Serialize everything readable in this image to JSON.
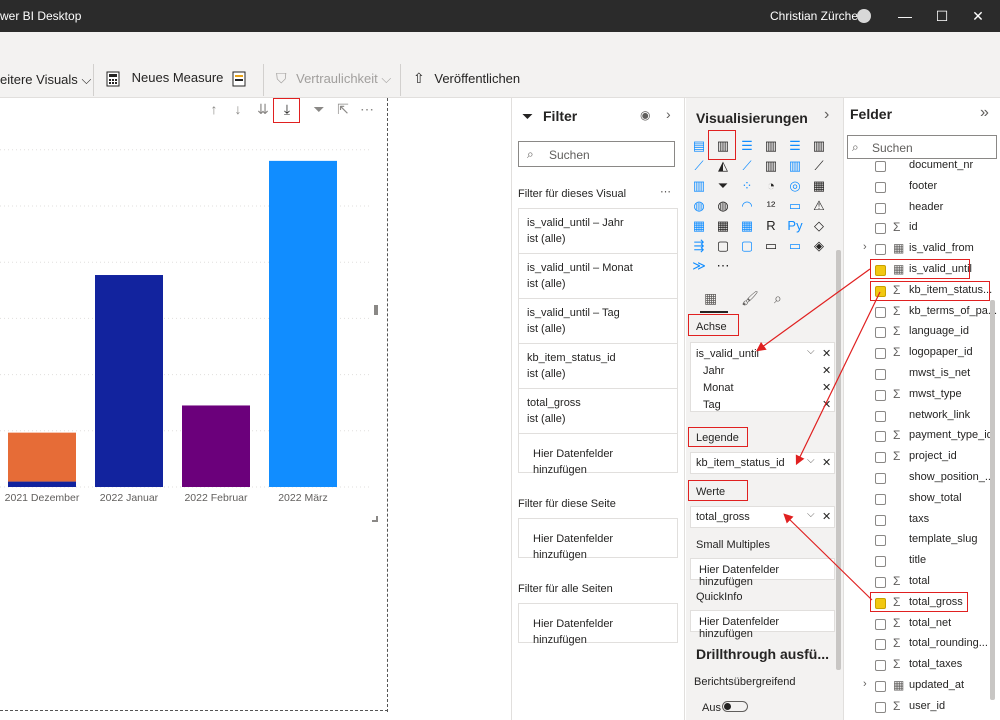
{
  "titlebar": {
    "title": "wer BI Desktop",
    "user": "Christian Zürcher",
    "min": "—",
    "max": "☐",
    "close": "✕"
  },
  "ribbon": {
    "more_visuals": "eitere Visuals",
    "new_measure": "Neues Measure",
    "sensitivity": "Vertraulichkeit",
    "publish": "Veröffentlichen"
  },
  "chart_data": {
    "type": "bar",
    "categories": [
      "2021 Dezember",
      "2022 Januar",
      "2022 Februar",
      "2022 März"
    ],
    "series": [
      {
        "values": [
          0.05,
          0,
          0,
          0
        ],
        "color": "#12239e"
      },
      {
        "values": [
          0.45,
          0,
          0,
          0
        ],
        "color": "#e66c37"
      },
      {
        "values": [
          0,
          1.95,
          0,
          0
        ],
        "color": "#12239e"
      },
      {
        "values": [
          0,
          0,
          0.75,
          0
        ],
        "color": "#6b007b"
      },
      {
        "values": [
          0,
          0,
          0,
          3.0
        ],
        "color": "#118dff"
      }
    ],
    "ylim": [
      0,
      3.1
    ],
    "grid": true
  },
  "filter": {
    "title": "Filter",
    "search_placeholder": "Suchen",
    "visual_section": "Filter für dieses Visual",
    "cards": [
      {
        "name": "is_valid_until – Jahr",
        "value": "ist (alle)"
      },
      {
        "name": "is_valid_until – Monat",
        "value": "ist (alle)"
      },
      {
        "name": "is_valid_until – Tag",
        "value": "ist (alle)"
      },
      {
        "name": "kb_item_status_id",
        "value": "ist (alle)"
      },
      {
        "name": "total_gross",
        "value": "ist (alle)"
      }
    ],
    "add_fields": "Hier Datenfelder hinzufügen",
    "page_section": "Filter für diese Seite",
    "all_section": "Filter für alle Seiten"
  },
  "viz": {
    "title": "Visualisierungen",
    "axis_label": "Achse",
    "axis_field": "is_valid_until",
    "axis_sub": [
      "Jahr",
      "Monat",
      "Tag"
    ],
    "legend_label": "Legende",
    "legend_field": "kb_item_status_id",
    "values_label": "Werte",
    "values_field": "total_gross",
    "small_multiples": "Small Multiples",
    "add_fields": "Hier Datenfelder hinzufügen",
    "quickinfo": "QuickInfo",
    "drillthrough": "Drillthrough ausfü...",
    "cross_report": "Berichtsübergreifend",
    "toggle_label": "Aus"
  },
  "fields": {
    "title": "Felder",
    "search_placeholder": "Suchen",
    "items": [
      {
        "name": "document_nr",
        "sigma": false,
        "checked": false
      },
      {
        "name": "footer",
        "sigma": false,
        "checked": false
      },
      {
        "name": "header",
        "sigma": false,
        "checked": false
      },
      {
        "name": "id",
        "sigma": true,
        "checked": false
      },
      {
        "name": "is_valid_from",
        "sigma": false,
        "checked": false,
        "date": true,
        "expand": true
      },
      {
        "name": "is_valid_until",
        "sigma": false,
        "checked": true,
        "date": true
      },
      {
        "name": "kb_item_status...",
        "sigma": true,
        "checked": true
      },
      {
        "name": "kb_terms_of_pa...",
        "sigma": true,
        "checked": false
      },
      {
        "name": "language_id",
        "sigma": true,
        "checked": false
      },
      {
        "name": "logopaper_id",
        "sigma": true,
        "checked": false
      },
      {
        "name": "mwst_is_net",
        "sigma": false,
        "checked": false
      },
      {
        "name": "mwst_type",
        "sigma": true,
        "checked": false
      },
      {
        "name": "network_link",
        "sigma": false,
        "checked": false
      },
      {
        "name": "payment_type_id",
        "sigma": true,
        "checked": false
      },
      {
        "name": "project_id",
        "sigma": true,
        "checked": false
      },
      {
        "name": "show_position_...",
        "sigma": false,
        "checked": false
      },
      {
        "name": "show_total",
        "sigma": false,
        "checked": false
      },
      {
        "name": "taxs",
        "sigma": false,
        "checked": false
      },
      {
        "name": "template_slug",
        "sigma": false,
        "checked": false
      },
      {
        "name": "title",
        "sigma": false,
        "checked": false
      },
      {
        "name": "total",
        "sigma": true,
        "checked": false
      },
      {
        "name": "total_gross",
        "sigma": true,
        "checked": true
      },
      {
        "name": "total_net",
        "sigma": true,
        "checked": false
      },
      {
        "name": "total_rounding...",
        "sigma": true,
        "checked": false
      },
      {
        "name": "total_taxes",
        "sigma": true,
        "checked": false
      },
      {
        "name": "updated_at",
        "sigma": false,
        "checked": false,
        "date": true,
        "expand": true
      },
      {
        "name": "user_id",
        "sigma": true,
        "checked": false
      }
    ]
  }
}
